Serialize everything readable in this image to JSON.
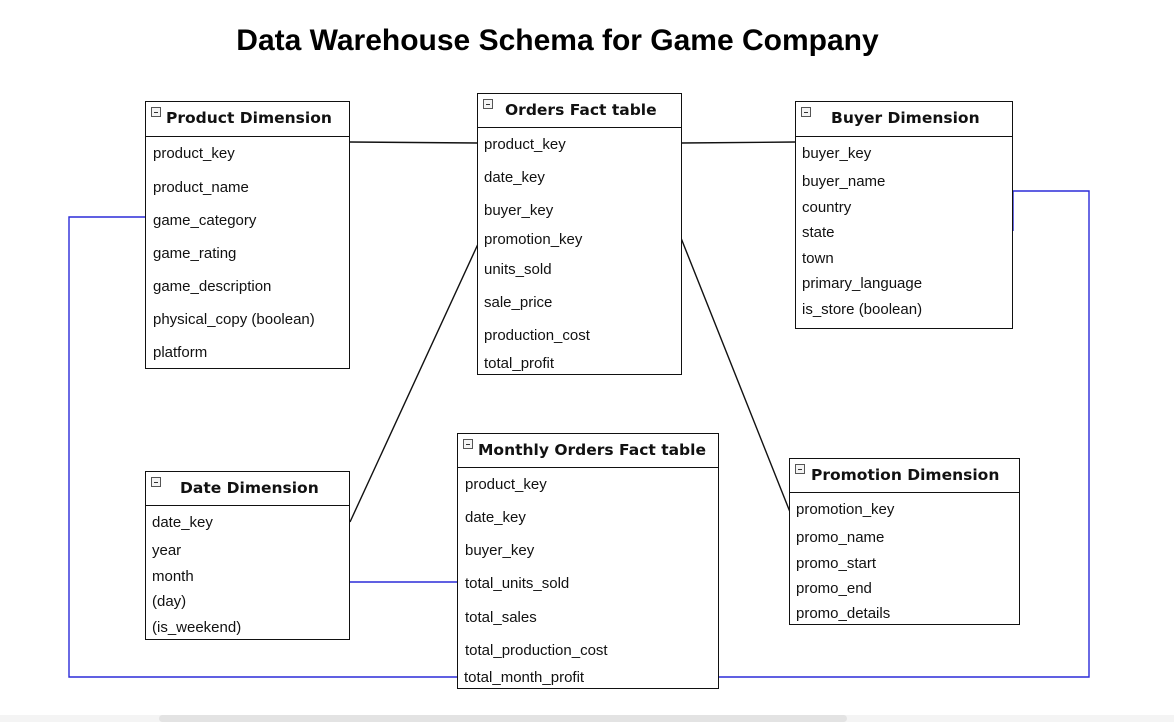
{
  "title": "Data Warehouse Schema for Game Company",
  "colors": {
    "fact_link": "#111111",
    "rollup_link": "#2b2bd8"
  },
  "entities": {
    "product": {
      "title": "Product Dimension",
      "fields": [
        "product_key",
        "product_name",
        "game_category",
        "game_rating",
        "game_description",
        "physical_copy (boolean)",
        "platform"
      ]
    },
    "orders": {
      "title": "Orders Fact table",
      "fields": [
        "product_key",
        "date_key",
        "buyer_key",
        "promotion_key",
        "units_sold",
        "sale_price",
        "production_cost",
        "total_profit"
      ]
    },
    "buyer": {
      "title": "Buyer Dimension",
      "fields": [
        "buyer_key",
        "buyer_name",
        "country",
        "state",
        "town",
        "primary_language",
        "is_store (boolean)"
      ]
    },
    "date": {
      "title": "Date Dimension",
      "fields": [
        "date_key",
        "year",
        "month",
        "(day)",
        "(is_weekend)"
      ]
    },
    "monthly": {
      "title": "Monthly Orders Fact table",
      "fields": [
        "product_key",
        "date_key",
        "buyer_key",
        "total_units_sold",
        "total_sales",
        "total_production_cost",
        "total_month_profit"
      ]
    },
    "promotion": {
      "title": "Promotion Dimension",
      "fields": [
        "promotion_key",
        "promo_name",
        "promo_start",
        "promo_end",
        "promo_details"
      ]
    }
  }
}
